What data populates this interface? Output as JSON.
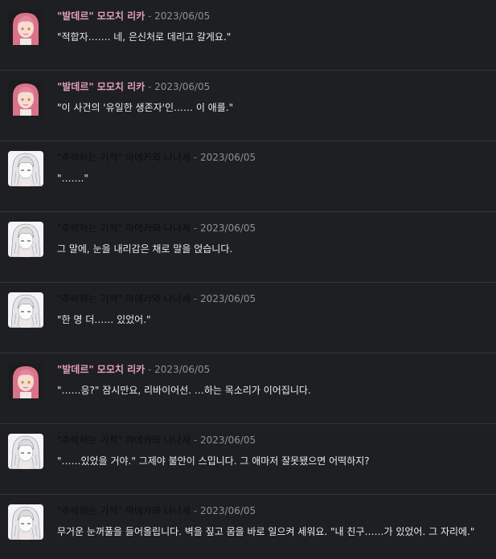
{
  "messages": [
    {
      "avatar": "pink-hair-avatar",
      "name": "\"발데르\" 모모치 리카",
      "name_style": "pink",
      "sep": " - ",
      "date": "2023/06/05",
      "text": "\"적합자……. 네, 은신처로 데리고 갈게요.\""
    },
    {
      "avatar": "pink-hair-avatar",
      "name": "\"발데르\" 모모치 리카",
      "name_style": "pink",
      "sep": " - ",
      "date": "2023/06/05",
      "text": "\"이 사건의 '유일한 생존자'인…… 이 애를.\""
    },
    {
      "avatar": "white-hair-avatar",
      "name": "\"추락하는 기적\" 마에카와 나나세",
      "name_style": "dark",
      "sep": " - ",
      "date": "2023/06/05",
      "text": "\"…….\""
    },
    {
      "avatar": "white-hair-avatar",
      "name": "\"추락하는 기적\" 마에카와 나나세",
      "name_style": "dark",
      "sep": " - ",
      "date": "2023/06/05",
      "text": "그 말에, 눈을 내리감은 채로 말을 얹습니다."
    },
    {
      "avatar": "white-hair-avatar",
      "name": "\"추락하는 기적\" 마에카와 나나세",
      "name_style": "dark",
      "sep": " - ",
      "date": "2023/06/05",
      "text": "\"한 명 더…… 있었어.\""
    },
    {
      "avatar": "pink-hair-avatar",
      "name": "\"발데르\" 모모치 리카",
      "name_style": "pink",
      "sep": " - ",
      "date": "2023/06/05",
      "text": "\"……응?\" 잠시만요, 리바이어선. …하는 목소리가 이어집니다."
    },
    {
      "avatar": "white-hair-avatar",
      "name": "\"추락하는 기적\" 마에카와 나나세",
      "name_style": "dark",
      "sep": " - ",
      "date": "2023/06/05",
      "text": "\"……있었을 거야.\" 그제야 불안이 스밉니다. 그 애마저 잘못됐으면 어떡하지?"
    },
    {
      "avatar": "white-hair-avatar",
      "name": "\"추락하는 기적\" 마에카와 나나세",
      "name_style": "dark",
      "sep": " - ",
      "date": "2023/06/05",
      "text": "무거운 눈꺼풀을 들어올립니다. 벽을 짚고 몸을 바로 일으켜 세워요. \"내 친구……가 있었어. 그 자리에.\""
    }
  ],
  "colors": {
    "background": "#1e1f22",
    "divider": "#34363b",
    "pink_name": "#e2a0b6",
    "dark_name": "#0d0d0e",
    "date": "#8d8f95",
    "text": "#eaeaec"
  }
}
